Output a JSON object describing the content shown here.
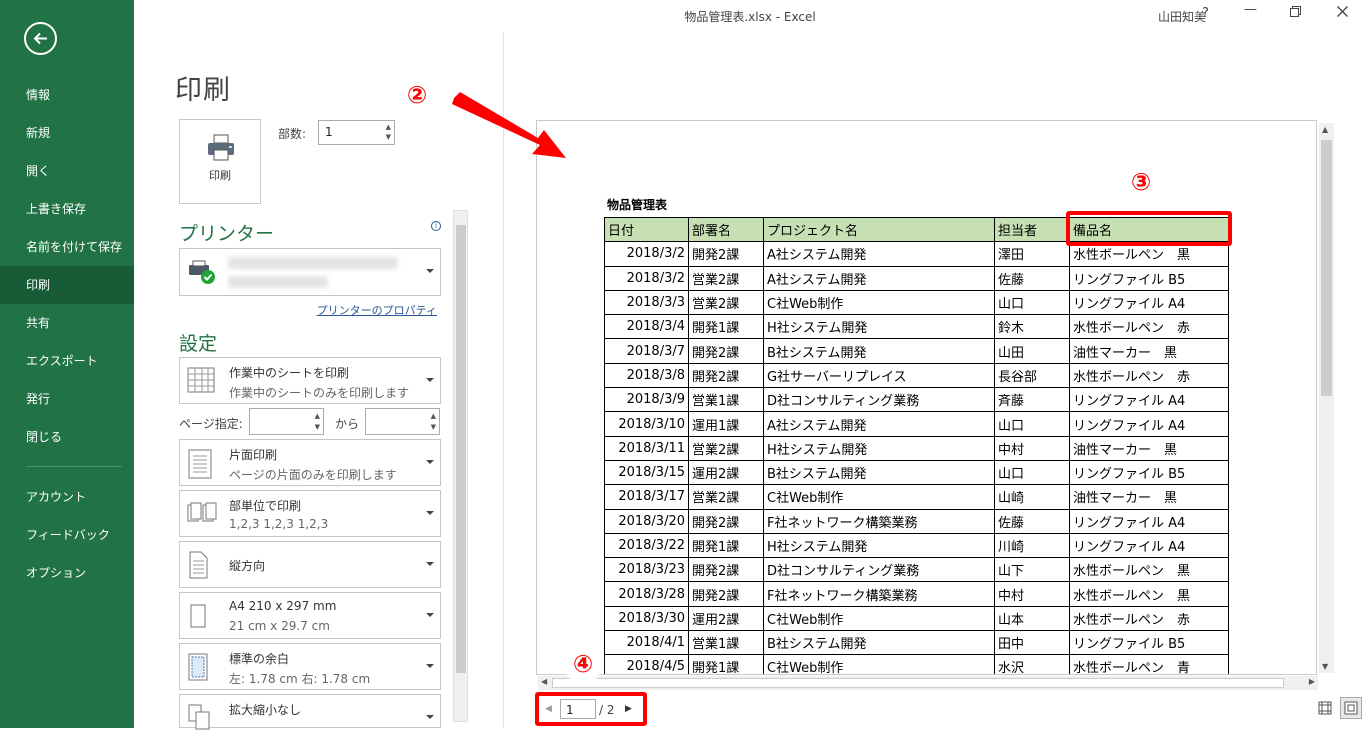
{
  "window": {
    "title": "物品管理表.xlsx  -  Excel",
    "user": "山田知美",
    "help": "?"
  },
  "sidebar": {
    "items": [
      {
        "label": "情報"
      },
      {
        "label": "新規"
      },
      {
        "label": "開く"
      },
      {
        "label": "上書き保存"
      },
      {
        "label": "名前を付けて保存"
      },
      {
        "label": "印刷"
      },
      {
        "label": "共有"
      },
      {
        "label": "エクスポート"
      },
      {
        "label": "発行"
      },
      {
        "label": "閉じる"
      },
      {
        "label": "アカウント"
      },
      {
        "label": "フィードバック"
      },
      {
        "label": "オプション"
      }
    ],
    "active": "印刷"
  },
  "print": {
    "page_title": "印刷",
    "button_label": "印刷",
    "copies_label": "部数:",
    "copies_value": "1",
    "printer_heading": "プリンター",
    "printer_properties": "プリンターのプロパティ",
    "settings_heading": "設定",
    "settings": [
      {
        "line1": "作業中のシートを印刷",
        "line2": "作業中のシートのみを印刷します"
      },
      {
        "line1": "片面印刷",
        "line2": "ページの片面のみを印刷します"
      },
      {
        "line1": "部単位で印刷",
        "line2": "1,2,3    1,2,3    1,2,3"
      },
      {
        "line1": "縦方向",
        "line2": ""
      },
      {
        "line1": "A4 210 x 297 mm",
        "line2": "21 cm x 29.7 cm"
      },
      {
        "line1": "標準の余白",
        "line2": "左:  1.78 cm    右:  1.78 cm"
      },
      {
        "line1": "拡大縮小なし",
        "line2": ""
      }
    ],
    "pages_label": "ページ指定:",
    "pages_to": "から"
  },
  "navigation": {
    "current_page": "1",
    "total_pages": "/ 2"
  },
  "annotations": {
    "two": "②",
    "three": "③",
    "four": "④"
  },
  "sheet": {
    "title": "物品管理表",
    "headers": [
      "日付",
      "部署名",
      "プロジェクト名",
      "担当者",
      "備品名"
    ],
    "rows": [
      [
        "2018/3/2",
        "開発2課",
        "A社システム開発",
        "澤田",
        "水性ボールペン　黒"
      ],
      [
        "2018/3/2",
        "営業2課",
        "A社システム開発",
        "佐藤",
        "リングファイル B5"
      ],
      [
        "2018/3/3",
        "営業2課",
        "C社Web制作",
        "山口",
        "リングファイル A4"
      ],
      [
        "2018/3/4",
        "開発1課",
        "H社システム開発",
        "鈴木",
        "水性ボールペン　赤"
      ],
      [
        "2018/3/7",
        "開発2課",
        "B社システム開発",
        "山田",
        "油性マーカー　黒"
      ],
      [
        "2018/3/8",
        "開発2課",
        "G社サーバーリプレイス",
        "長谷部",
        "水性ボールペン　赤"
      ],
      [
        "2018/3/9",
        "営業1課",
        "D社コンサルティング業務",
        "斉藤",
        "リングファイル A4"
      ],
      [
        "2018/3/10",
        "運用1課",
        "A社システム開発",
        "山口",
        "リングファイル A4"
      ],
      [
        "2018/3/11",
        "営業2課",
        "H社システム開発",
        "中村",
        "油性マーカー　黒"
      ],
      [
        "2018/3/15",
        "運用2課",
        "B社システム開発",
        "山口",
        "リングファイル B5"
      ],
      [
        "2018/3/17",
        "営業2課",
        "C社Web制作",
        "山崎",
        "油性マーカー　黒"
      ],
      [
        "2018/3/20",
        "開発2課",
        "F社ネットワーク構築業務",
        "佐藤",
        "リングファイル A4"
      ],
      [
        "2018/3/22",
        "開発1課",
        "H社システム開発",
        "川崎",
        "リングファイル A4"
      ],
      [
        "2018/3/23",
        "開発2課",
        "D社コンサルティング業務",
        "山下",
        "水性ボールペン　黒"
      ],
      [
        "2018/3/28",
        "開発2課",
        "F社ネットワーク構築業務",
        "中村",
        "水性ボールペン　黒"
      ],
      [
        "2018/3/30",
        "運用2課",
        "C社Web制作",
        "山本",
        "水性ボールペン　赤"
      ],
      [
        "2018/4/1",
        "営業1課",
        "B社システム開発",
        "田中",
        "リングファイル B5"
      ],
      [
        "2018/4/5",
        "開発1課",
        "C社Web制作",
        "水沢",
        "水性ボールペン　青"
      ]
    ]
  },
  "colors": {
    "sidebar": "#217346",
    "sidebar_active": "#185c37",
    "header_fill": "#c6e0b4",
    "annotation": "#ff0000"
  }
}
